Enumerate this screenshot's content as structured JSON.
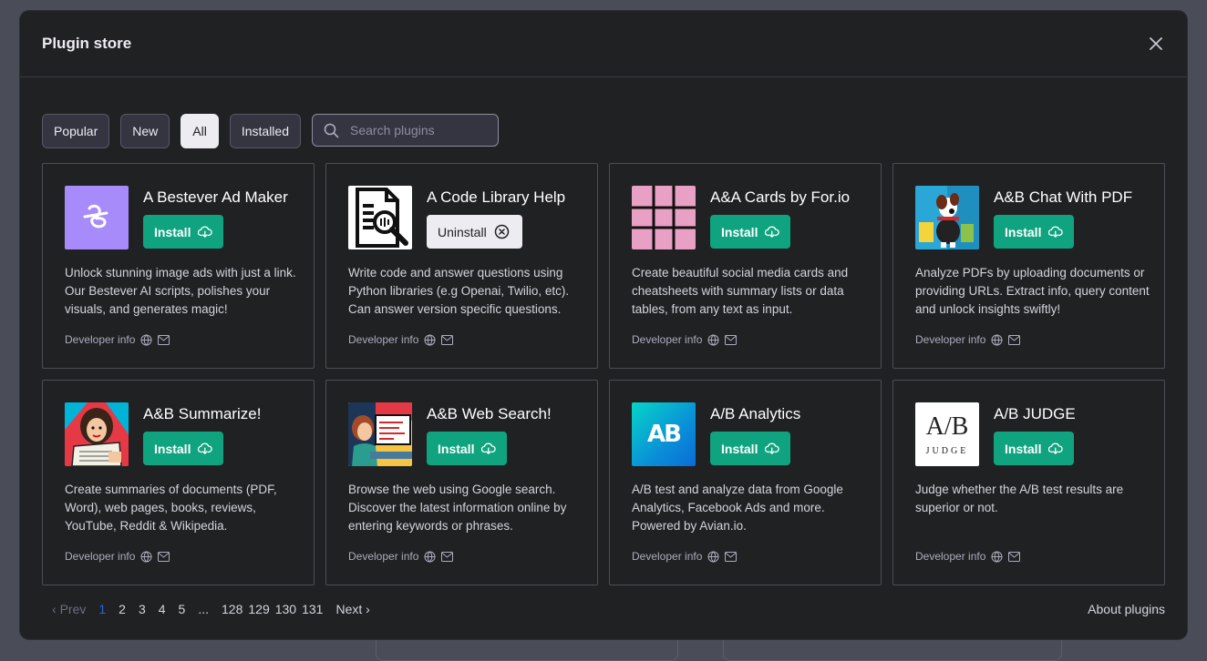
{
  "modal": {
    "title": "Plugin store"
  },
  "filters": {
    "tabs": [
      {
        "label": "Popular",
        "active": false
      },
      {
        "label": "New",
        "active": false
      },
      {
        "label": "All",
        "active": true
      },
      {
        "label": "Installed",
        "active": false
      }
    ],
    "search_placeholder": "Search plugins",
    "search_value": ""
  },
  "plugins": [
    {
      "name": "A Bestever Ad Maker",
      "action": "Install",
      "logo": "bestever-logo",
      "description": "Unlock stunning image ads with just a link. Our Bestever AI scripts, polishes your visuals, and generates magic!",
      "dev_label": "Developer info"
    },
    {
      "name": "A Code Library Help",
      "action": "Uninstall",
      "logo": "code-library-logo",
      "description": "Write code and answer questions using Python libraries (e.g Openai, Twilio, etc). Can answer version specific questions.",
      "dev_label": "Developer info"
    },
    {
      "name": "A&A Cards by For.io",
      "action": "Install",
      "logo": "cards-grid-logo",
      "description": "Create beautiful social media cards and cheatsheets with summary lists or data tables, from any text as input.",
      "dev_label": "Developer info"
    },
    {
      "name": "A&B Chat With PDF",
      "action": "Install",
      "logo": "dog-logo",
      "description": "Analyze PDFs by uploading documents or providing URLs. Extract info, query content and unlock insights swiftly!",
      "dev_label": "Developer info"
    },
    {
      "name": "A&B Summarize!",
      "action": "Install",
      "logo": "pop-art-woman-logo",
      "description": "Create summaries of documents (PDF, Word), web pages, books, reviews, YouTube, Reddit & Wikipedia.",
      "dev_label": "Developer info"
    },
    {
      "name": "A&B Web Search!",
      "action": "Install",
      "logo": "pop-art-computer-logo",
      "description": "Browse the web using Google search. Discover the latest information online by entering keywords or phrases.",
      "dev_label": "Developer info"
    },
    {
      "name": "A/B Analytics",
      "action": "Install",
      "logo": "ab-analytics-logo",
      "description": "A/B test and analyze data from Google Analytics, Facebook Ads and more. Powered by Avian.io.",
      "dev_label": "Developer info"
    },
    {
      "name": "A/B JUDGE",
      "action": "Install",
      "logo": "ab-judge-logo",
      "description": "Judge whether the A/B test results are superior or not.",
      "dev_label": "Developer info"
    }
  ],
  "logo_text": {
    "ab_analytics": "AB",
    "ab_judge_top": "A/B",
    "ab_judge_bottom": "JUDGE"
  },
  "pagination": {
    "prev": "Prev",
    "next": "Next",
    "pages": [
      "1",
      "2",
      "3",
      "4",
      "5",
      "...",
      "128",
      "129",
      "130",
      "131"
    ],
    "current": "1"
  },
  "about_link": "About plugins",
  "colors": {
    "accent_install": "#10a37f",
    "modal_bg": "#202123",
    "current_page": "#2f63d6"
  }
}
